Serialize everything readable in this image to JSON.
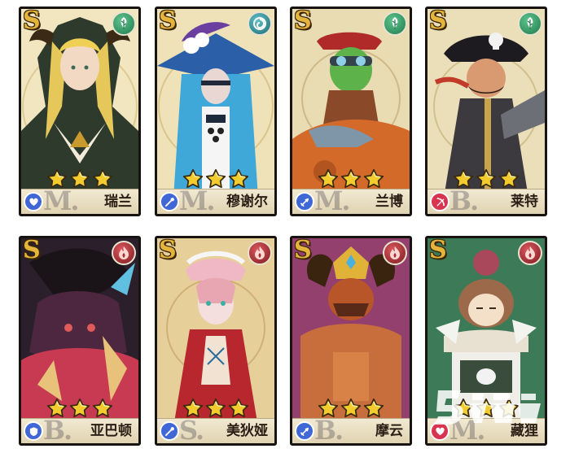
{
  "cards": [
    {
      "rank": "S",
      "faction_icon": "leaf-icon",
      "class_icon": "heart-shield-icon",
      "class_letter": "M.",
      "name": "瑞兰",
      "stars": 3
    },
    {
      "rank": "S",
      "faction_icon": "swirl-icon",
      "class_icon": "staff-icon",
      "class_letter": "M.",
      "name": "穆谢尔",
      "stars": 3
    },
    {
      "rank": "S",
      "faction_icon": "leaf-icon",
      "class_icon": "sword-icon",
      "class_letter": "M.",
      "name": "兰博",
      "stars": 3
    },
    {
      "rank": "S",
      "faction_icon": "leaf-icon",
      "class_icon": "bow-icon",
      "class_letter": "B.",
      "name": "莱特",
      "stars": 3
    },
    {
      "rank": "S",
      "faction_icon": "flame-icon",
      "class_icon": "shield-icon",
      "class_letter": "B.",
      "name": "亚巴顿",
      "stars": 3
    },
    {
      "rank": "S",
      "faction_icon": "flame-icon",
      "class_icon": "staff-icon",
      "class_letter": "S.",
      "name": "美狄娅",
      "stars": 3
    },
    {
      "rank": "S",
      "faction_icon": "flame-icon",
      "class_icon": "sword-icon",
      "class_letter": "B.",
      "name": "摩云",
      "stars": 3
    },
    {
      "rank": "S",
      "faction_icon": "flame-icon",
      "class_icon": "heart-shield-icon",
      "class_letter": "M.",
      "name": "藏狸",
      "stars": 3
    }
  ],
  "colors": {
    "card_border": "#171310",
    "rank_gold": "#e5b43c",
    "star_gold": "#f2cc2e",
    "faction_green": "#2e8f5e",
    "faction_teal": "#2a8a93",
    "faction_red": "#a32b33",
    "class_blue": "#3f68d6",
    "class_red": "#d8344f",
    "name_bar": "#ece2c6"
  },
  "watermark_icon": "site-logo-watermark"
}
